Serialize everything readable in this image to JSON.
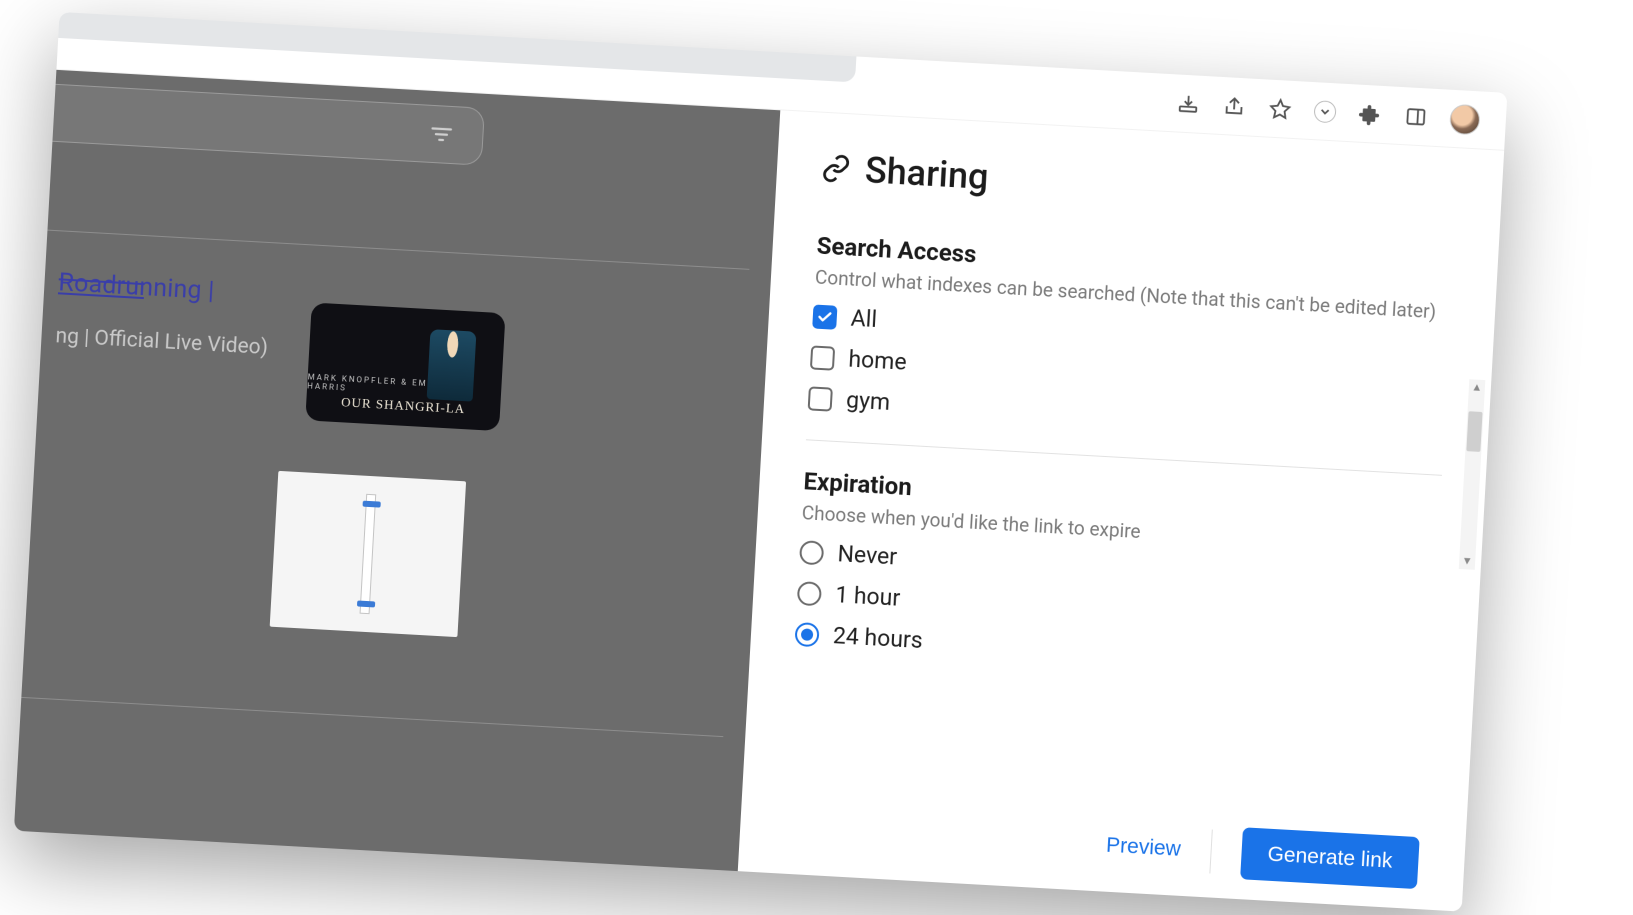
{
  "chrome": {
    "icons": [
      "install-icon",
      "share-icon",
      "star-icon",
      "chevron-down-icon",
      "extensions-icon",
      "sidepanel-icon",
      "avatar"
    ]
  },
  "left": {
    "result_title": "Roadrunning |",
    "result_subtitle": "ng | Official Live Video)",
    "thumb1_top": "MARK KNOPFLER & EMMYLOU HARRIS",
    "thumb1_main": "OUR SHANGRI-LA"
  },
  "panel": {
    "title": "Sharing",
    "search_access": {
      "heading": "Search Access",
      "desc": "Control what indexes can be searched (Note that this can't be edited later)",
      "options": [
        {
          "label": "All",
          "checked": true
        },
        {
          "label": "home",
          "checked": false
        },
        {
          "label": "gym",
          "checked": false
        }
      ]
    },
    "expiration": {
      "heading": "Expiration",
      "desc": "Choose when you'd like the link to expire",
      "options": [
        {
          "label": "Never",
          "selected": false
        },
        {
          "label": "1 hour",
          "selected": false
        },
        {
          "label": "24 hours",
          "selected": true
        }
      ]
    },
    "footer": {
      "preview": "Preview",
      "generate": "Generate link"
    }
  }
}
